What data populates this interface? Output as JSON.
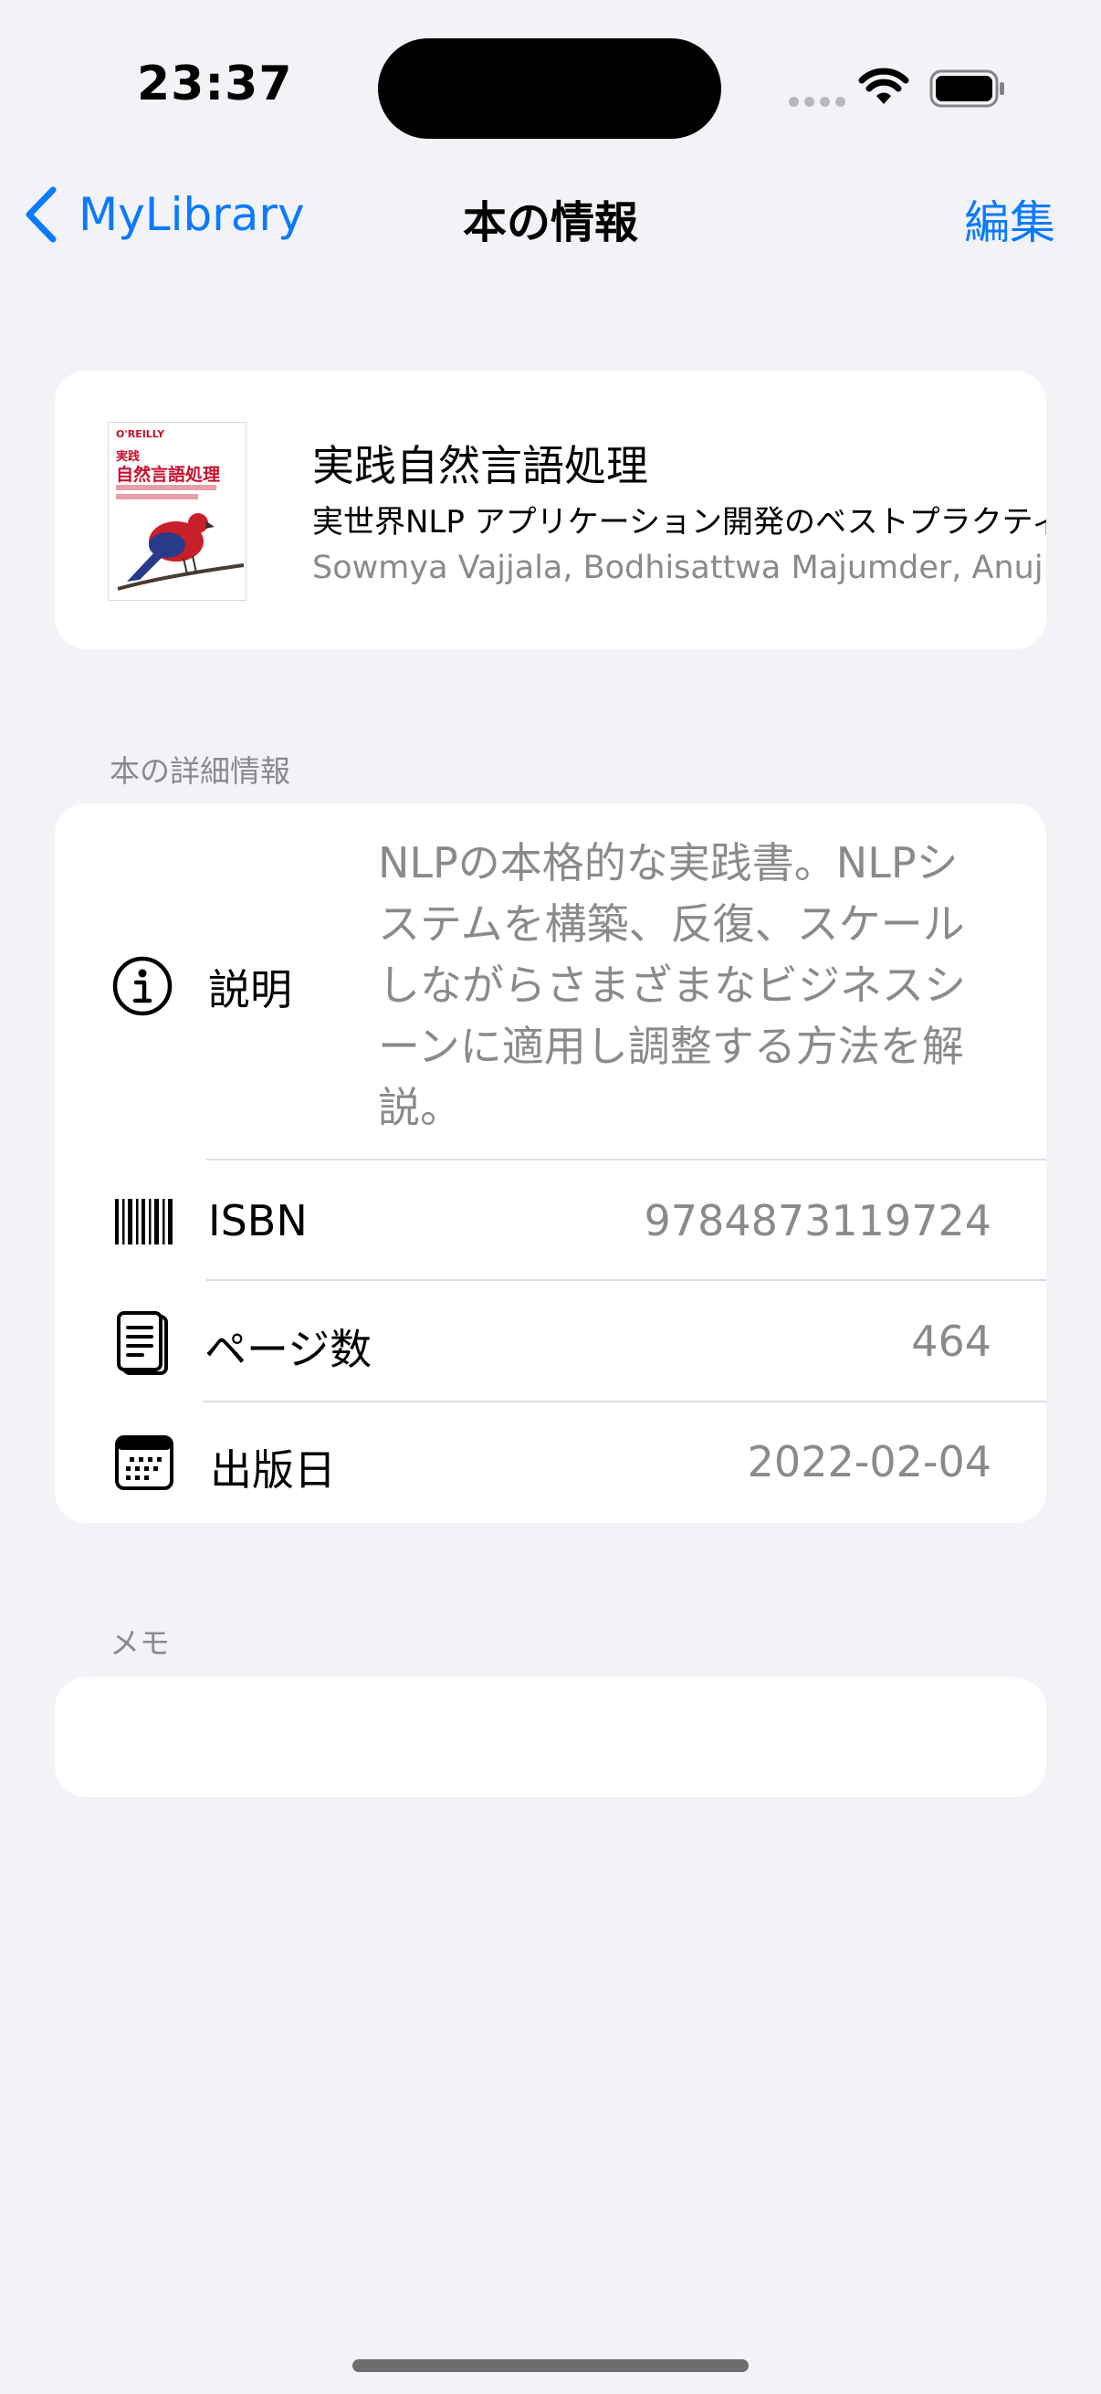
{
  "status_bar": {
    "time": "23:37"
  },
  "nav": {
    "back_label": "MyLibrary",
    "title": "本の情報",
    "edit_label": "編集"
  },
  "book": {
    "title": "実践自然言語処理",
    "subtitle": "実世界NLP アプリケーション開発のベストプラクティス",
    "authors": "Sowmya Vajjala, Bodhisattwa Majumder, Anuj Gupta, Harshit Surana",
    "cover": {
      "brand": "O'REILLY",
      "title_small": "実践",
      "title_large": "自然言語処理"
    }
  },
  "details_section": {
    "header": "本の詳細情報",
    "description": {
      "label": "説明",
      "value": "NLPの本格的な実践書。NLPシステムを構築、反復、スケールしながらさまざまなビジネスシーンに適用し調整する方法を解説。",
      "icon": "info-icon"
    },
    "isbn": {
      "label": "ISBN",
      "value": "9784873119724",
      "icon": "barcode-icon"
    },
    "pages": {
      "label": "ページ数",
      "value": "464",
      "icon": "document-pages-icon"
    },
    "published": {
      "label": "出版日",
      "value": "2022-02-04",
      "icon": "calendar-icon"
    }
  },
  "memo_section": {
    "header": "メモ",
    "value": ""
  },
  "colors": {
    "accent": "#0A7AFF",
    "background": "#F2F2F7",
    "secondary_text": "#8A8A8E"
  }
}
